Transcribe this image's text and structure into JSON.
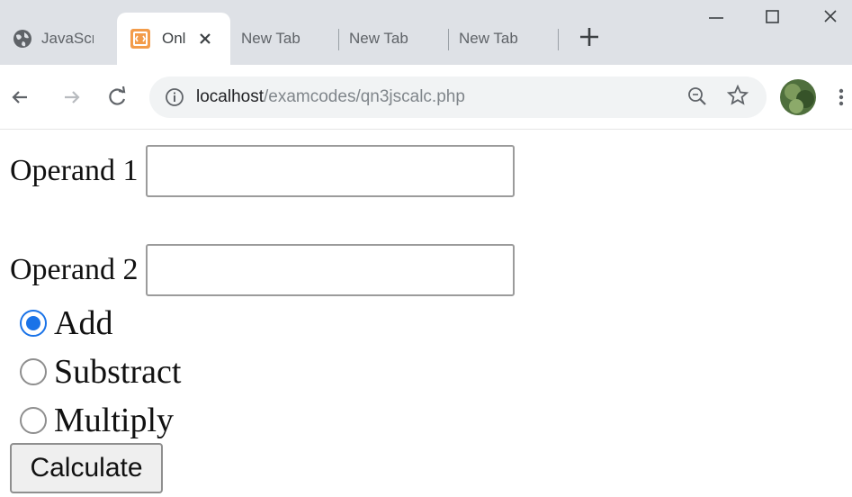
{
  "browser": {
    "tabs": [
      {
        "label": "JavaScr",
        "icon": "globe-icon",
        "active": false
      },
      {
        "label": "Onl",
        "icon": "html-favicon-icon",
        "active": true
      },
      {
        "label": "New Tab",
        "active": false
      },
      {
        "label": "New Tab",
        "active": false
      },
      {
        "label": "New Tab",
        "active": false
      }
    ],
    "address": {
      "host": "localhost",
      "path": "/examcodes/qn3jscalc.php"
    },
    "accent_color": "#1a73e8",
    "favicon_color": "#f39c4a"
  },
  "form": {
    "operand1_label": "Operand 1",
    "operand1_value": "",
    "operand2_label": "Operand 2",
    "operand2_value": "",
    "operations": [
      {
        "label": "Add",
        "checked": true
      },
      {
        "label": "Substract",
        "checked": false
      },
      {
        "label": "Multiply",
        "checked": false
      }
    ],
    "calculate_label": "Calculate"
  }
}
